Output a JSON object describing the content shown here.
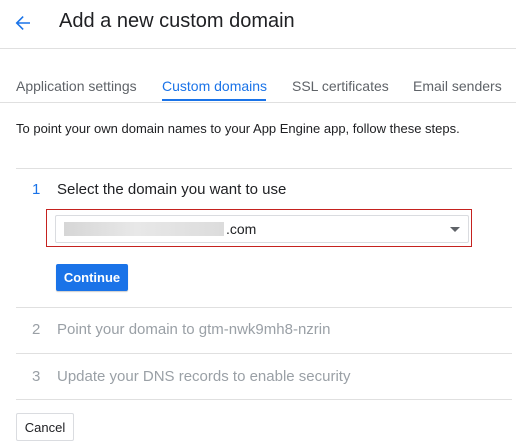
{
  "header": {
    "title": "Add a new custom domain",
    "back_icon": "arrow-back-icon",
    "accent": "#1a73e8"
  },
  "tabs": [
    {
      "label": "Application settings",
      "active": false
    },
    {
      "label": "Custom domains",
      "active": true
    },
    {
      "label": "SSL certificates",
      "active": false
    },
    {
      "label": "Email senders",
      "active": false
    }
  ],
  "intro": "To point your own domain names to your App Engine app, follow these steps.",
  "steps": [
    {
      "number": "1",
      "label": "Select the domain you want to use",
      "state": "active"
    },
    {
      "number": "2",
      "label": "Point your domain to gtm-nwk9mh8-nzrin",
      "state": "disabled"
    },
    {
      "number": "3",
      "label": "Update your DNS records to enable security",
      "state": "disabled"
    }
  ],
  "domain_select": {
    "value_suffix": ".com",
    "highlight_color": "#c5221f"
  },
  "buttons": {
    "continue_label": "Continue",
    "cancel_label": "Cancel"
  }
}
